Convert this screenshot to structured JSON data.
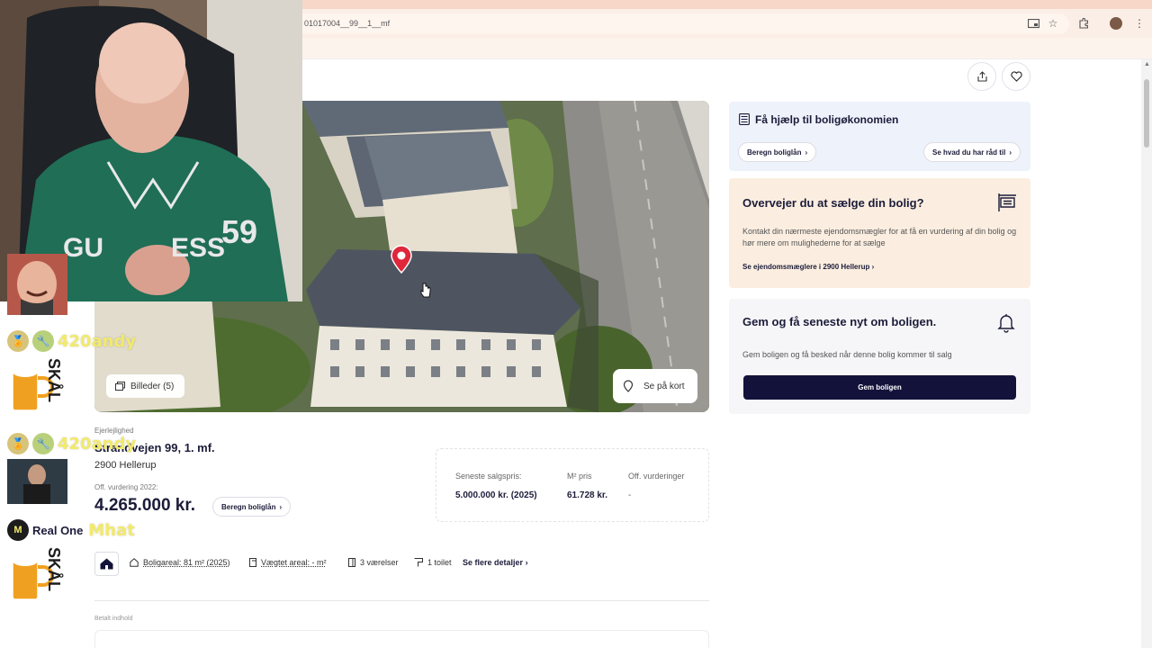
{
  "browser": {
    "url": "01017004__99__1__mf"
  },
  "listing": {
    "property_type": "Ejerlejlighed",
    "address": "Strandvejen 99, 1. mf.",
    "postal_city": "2900 Hellerup",
    "valuation_label": "Off. vurdering 2022:",
    "valuation_price": "4.265.000 kr.",
    "loan_button": "Beregn boliglån",
    "images_button": "Billeder (5)",
    "map_button": "Se på kort",
    "stats": {
      "last_sale_label": "Seneste salgspris:",
      "last_sale_value": "5.000.000 kr. (2025)",
      "sqm_price_label": "M² pris",
      "sqm_price_value": "61.728 kr.",
      "valuations_label": "Off. vurderinger",
      "valuations_value": "-"
    },
    "features": {
      "living_area": "Boligareal: 81 m² (2025)",
      "weighted_area": "Vægtet areal: - m²",
      "rooms": "3 værelser",
      "toilets": "1 toilet",
      "more": "Se flere detaljer"
    },
    "paid_content_label": "Betalt indhold"
  },
  "sidebar": {
    "finance_card": {
      "title": "Få hjælp til boligøkonomien",
      "loan_link": "Beregn boliglån",
      "budget_link": "Se hvad du har råd til"
    },
    "sell_card": {
      "title": "Overvejer du at sælge din bolig?",
      "text": "Kontakt din nærmeste ejendomsmægler for at få en vurdering af din bolig og hør mere om mulighederne for at sælge",
      "link": "Se ejendomsmæglere i 2900 Hellerup"
    },
    "save_card": {
      "title": "Gem og få seneste nyt om boligen.",
      "text": "Gem boligen og få besked når denne bolig kommer til salg",
      "button": "Gem boligen"
    }
  },
  "chat": {
    "messages": [
      {
        "user": "420andy",
        "emote": "SKÅL"
      },
      {
        "user": "420andy"
      },
      {
        "user": "Real One",
        "message": "Mhat",
        "emote": "SKÅL"
      }
    ]
  },
  "colors": {
    "brand_dark": "#12123a",
    "finance_card_bg": "#eef2fb",
    "sell_card_bg": "#fbeee0",
    "map_pin": "#e0263a",
    "chat_yellow": "#f2ea6a"
  },
  "icons": [
    "share-icon",
    "heart-icon",
    "calculator-icon",
    "sign-icon",
    "bell-icon",
    "gallery-icon",
    "map-pin-icon",
    "home-icon",
    "area-icon",
    "ruler-icon",
    "room-icon",
    "toilet-icon",
    "chevron-right-icon"
  ]
}
